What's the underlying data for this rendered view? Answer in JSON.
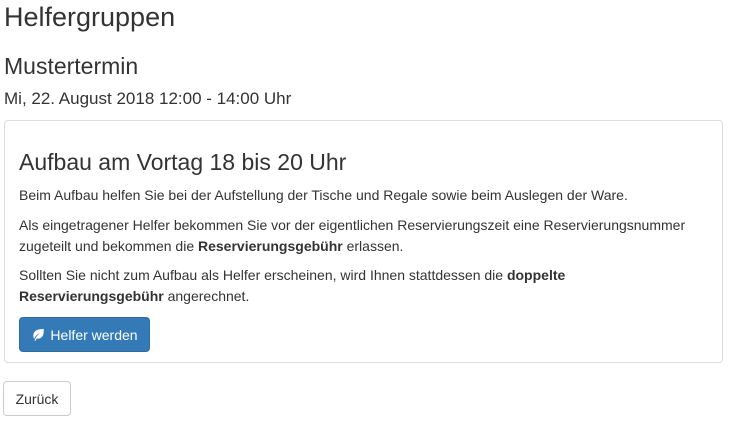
{
  "page": {
    "title": "Helfergruppen"
  },
  "event": {
    "name": "Mustertermin",
    "datetime": "Mi, 22. August 2018 12:00 - 14:00 Uhr"
  },
  "group": {
    "title": "Aufbau am Vortag 18 bis 20 Uhr",
    "paragraph1": "Beim Aufbau helfen Sie bei der Aufstellung der Tische und Regale sowie beim Auslegen der Ware.",
    "paragraph2_part1": "Als eingetragener Helfer bekommen Sie vor der eigentlichen Reservierungszeit eine Reservierungsnummer zugeteilt und bekommen die ",
    "paragraph2_bold": "Reservierungsgebühr",
    "paragraph2_part2": " erlassen.",
    "paragraph3_part1": "Sollten Sie nicht zum Aufbau als Helfer erscheinen, wird Ihnen stattdessen die ",
    "paragraph3_bold": "doppelte Reservierungsgebühr",
    "paragraph3_part2": " angerechnet.",
    "button_label": "Helfer werden",
    "button_icon": "leaf-icon"
  },
  "footer": {
    "back_label": "Zurück"
  },
  "colors": {
    "primary": "#337ab7",
    "text": "#333333",
    "border": "#dddddd"
  }
}
